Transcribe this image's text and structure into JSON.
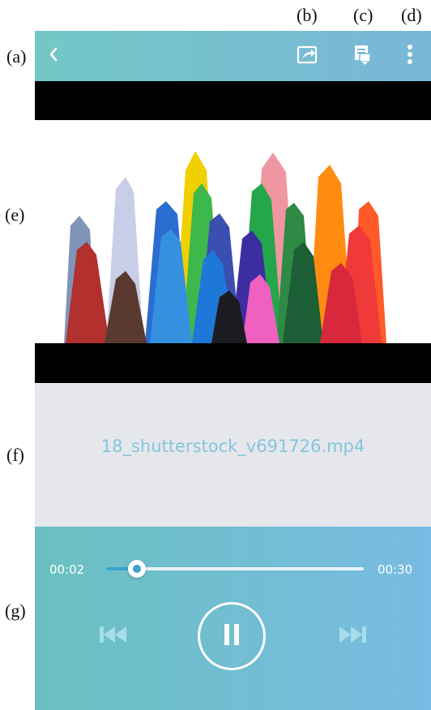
{
  "callouts": {
    "a": "(a)",
    "b": "(b)",
    "c": "(c)",
    "d": "(d)",
    "e": "(e)",
    "f": "(f)",
    "g": "(g)"
  },
  "topbar": {
    "back_icon": "chevron-left-icon",
    "share_icon": "share-arrow-icon",
    "cast_icon": "screen-cast-icon",
    "more_icon": "vertical-dots-icon",
    "gradient": [
      "#73c8c6",
      "#7ab6d8"
    ]
  },
  "media": {
    "filename": "18_shutterstock_v691726.mp4",
    "thumbnail": "colored-crayon-tips-on-white"
  },
  "player": {
    "time_elapsed": "00:02",
    "time_total": "00:30",
    "progress": 0.118,
    "state": "playing",
    "prev_icon": "skip-previous-icon",
    "play_icon": "pause-icon",
    "next_icon": "skip-next-icon",
    "accent": "#3aa3cf"
  }
}
